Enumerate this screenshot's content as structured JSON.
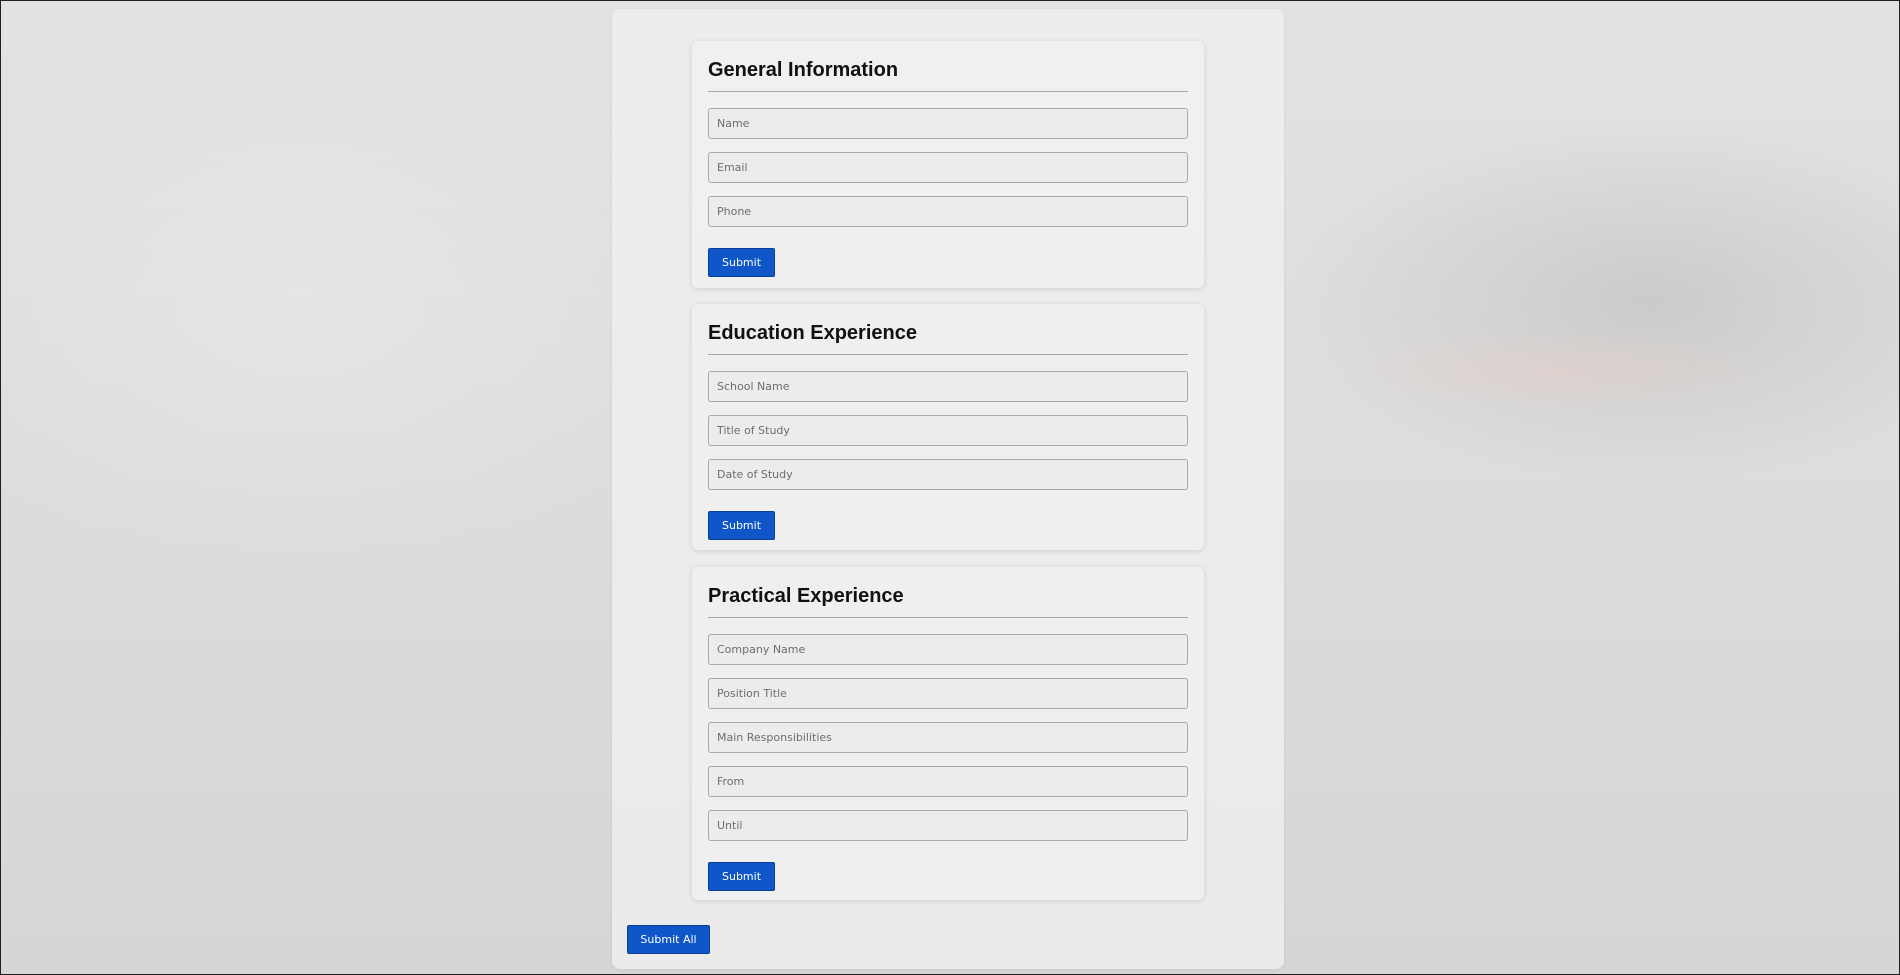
{
  "sections": {
    "general": {
      "title": "General Information",
      "fields": [
        {
          "placeholder": "Name",
          "value": ""
        },
        {
          "placeholder": "Email",
          "value": ""
        },
        {
          "placeholder": "Phone",
          "value": ""
        }
      ],
      "submit_label": "Submit"
    },
    "education": {
      "title": "Education Experience",
      "fields": [
        {
          "placeholder": "School Name",
          "value": ""
        },
        {
          "placeholder": "Title of Study",
          "value": ""
        },
        {
          "placeholder": "Date of Study",
          "value": ""
        }
      ],
      "submit_label": "Submit"
    },
    "practical": {
      "title": "Practical Experience",
      "fields": [
        {
          "placeholder": "Company Name",
          "value": ""
        },
        {
          "placeholder": "Position Title",
          "value": ""
        },
        {
          "placeholder": "Main Responsibilities",
          "value": ""
        },
        {
          "placeholder": "From",
          "value": ""
        },
        {
          "placeholder": "Until",
          "value": ""
        }
      ],
      "submit_label": "Submit"
    }
  },
  "submit_all_label": "Submit All",
  "colors": {
    "button": "#0f57c9",
    "button_text": "#ffffff",
    "heading_text": "#111111"
  }
}
